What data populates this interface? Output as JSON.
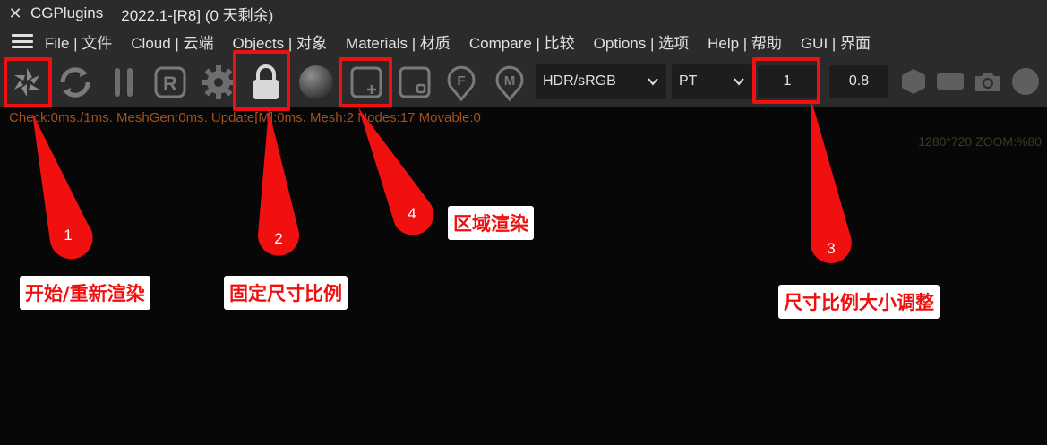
{
  "titlebar": {
    "close": "✕",
    "app": "CGPlugins",
    "version": "2022.1-[R8] (0 天剩余)"
  },
  "menu": [
    "File | 文件",
    "Cloud | 云端",
    "Objects | 对象",
    "Materials | 材质",
    "Compare | 比较",
    "Options | 选项",
    "Help | 帮助",
    "GUI | 界面"
  ],
  "toolbar": {
    "hdr_select": "HDR/sRGB",
    "mode_select": "PT",
    "ratio_value": "1",
    "scale_value": "0.8"
  },
  "status": "Check:0ms./1ms. MeshGen:0ms. Update[M]:0ms. Mesh:2 Nodes:17 Movable:0",
  "viewport": {
    "zoom": "1280*720 ZOOM:%80"
  },
  "annotations": {
    "n1": "1",
    "n2": "2",
    "n3": "3",
    "n4": "4",
    "l1": "开始/重新渲染",
    "l2": "固定尺寸比例",
    "l3": "尺寸比例大小调整",
    "l4": "区域渲染"
  },
  "colors": {
    "accent_red": "#f01010",
    "bg": "#070707",
    "bar": "#2b2b2b",
    "icon": "#8a8a8a"
  }
}
